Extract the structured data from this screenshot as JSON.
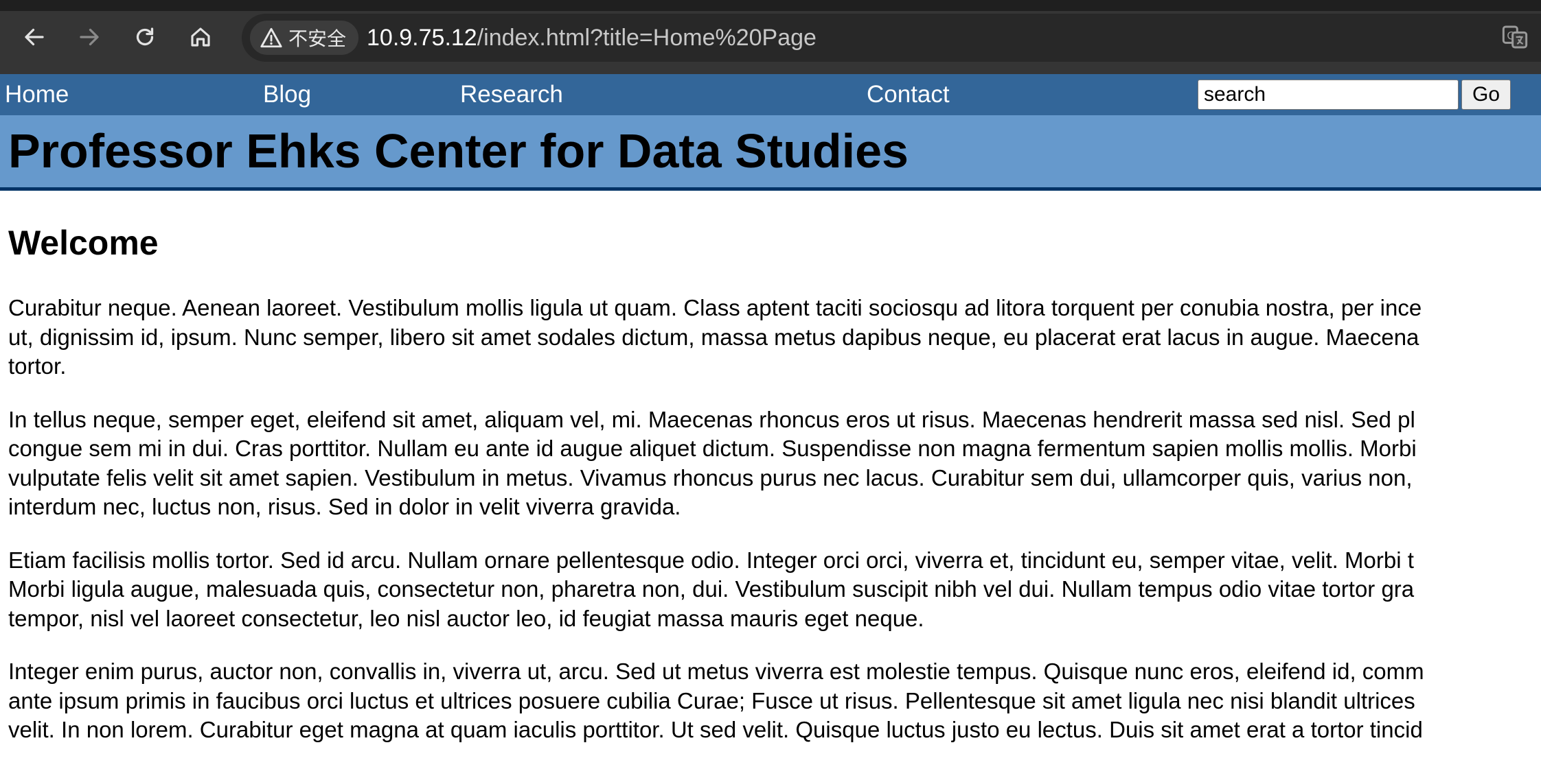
{
  "browser": {
    "security_label": "不安全",
    "url_host": "10.9.75.12",
    "url_rest": "/index.html?title=Home%20Page"
  },
  "nav": {
    "links": [
      "Home",
      "Blog",
      "Research",
      "Contact"
    ],
    "search_value": "search",
    "go_label": "Go"
  },
  "header": {
    "title": "Professor Ehks Center for Data Studies"
  },
  "main": {
    "heading": "Welcome",
    "paragraphs": [
      [
        "Curabitur neque. Aenean laoreet. Vestibulum mollis ligula ut quam. Class aptent taciti sociosqu ad litora torquent per conubia nostra, per ince",
        "ut, dignissim id, ipsum. Nunc semper, libero sit amet sodales dictum, massa metus dapibus neque, eu placerat erat lacus in augue. Maecena",
        "tortor."
      ],
      [
        "In tellus neque, semper eget, eleifend sit amet, aliquam vel, mi. Maecenas rhoncus eros ut risus. Maecenas hendrerit massa sed nisl. Sed pl",
        "congue sem mi in dui. Cras porttitor. Nullam eu ante id augue aliquet dictum. Suspendisse non magna fermentum sapien mollis mollis. Morbi",
        "vulputate felis velit sit amet sapien. Vestibulum in metus. Vivamus rhoncus purus nec lacus. Curabitur sem dui, ullamcorper quis, varius non,",
        "interdum nec, luctus non, risus. Sed in dolor in velit viverra gravida."
      ],
      [
        "Etiam facilisis mollis tortor. Sed id arcu. Nullam ornare pellentesque odio. Integer orci orci, viverra et, tincidunt eu, semper vitae, velit. Morbi t",
        "Morbi ligula augue, malesuada quis, consectetur non, pharetra non, dui. Vestibulum suscipit nibh vel dui. Nullam tempus odio vitae tortor gra",
        "tempor, nisl vel laoreet consectetur, leo nisl auctor leo, id feugiat massa mauris eget neque."
      ],
      [
        "Integer enim purus, auctor non, convallis in, viverra ut, arcu. Sed ut metus viverra est molestie tempus. Quisque nunc eros, eleifend id, comm",
        "ante ipsum primis in faucibus orci luctus et ultrices posuere cubilia Curae; Fusce ut risus. Pellentesque sit amet ligula nec nisi blandit ultrices",
        "velit. In non lorem. Curabitur eget magna at quam iaculis porttitor. Ut sed velit. Quisque luctus justo eu lectus. Duis sit amet erat a tortor tincid"
      ]
    ]
  }
}
